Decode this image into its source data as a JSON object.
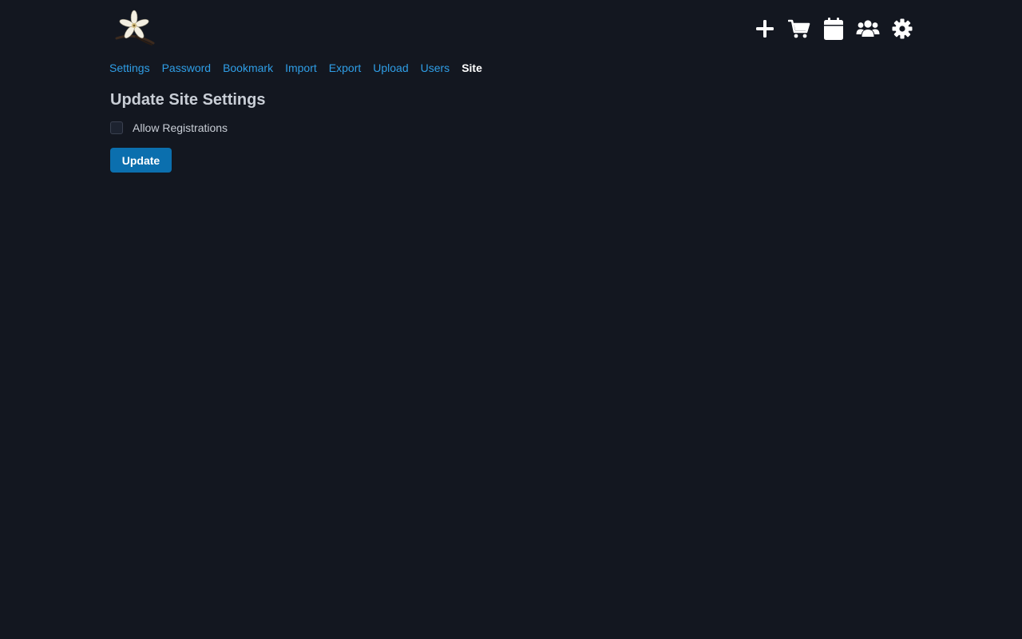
{
  "header": {
    "logo_icon": "vanilla-flower-icon",
    "toolbar": [
      {
        "icon": "plus-icon",
        "name": "add"
      },
      {
        "icon": "cart-icon",
        "name": "cart"
      },
      {
        "icon": "calendar-icon",
        "name": "calendar"
      },
      {
        "icon": "users-icon",
        "name": "users"
      },
      {
        "icon": "gear-icon",
        "name": "settings"
      }
    ]
  },
  "nav": {
    "items": [
      {
        "label": "Settings",
        "active": false
      },
      {
        "label": "Password",
        "active": false
      },
      {
        "label": "Bookmark",
        "active": false
      },
      {
        "label": "Import",
        "active": false
      },
      {
        "label": "Export",
        "active": false
      },
      {
        "label": "Upload",
        "active": false
      },
      {
        "label": "Users",
        "active": false
      },
      {
        "label": "Site",
        "active": true
      }
    ]
  },
  "main": {
    "title": "Update Site Settings",
    "allow_registrations": {
      "label": "Allow Registrations",
      "checked": false
    },
    "update_label": "Update"
  },
  "colors": {
    "background": "#131720",
    "link": "#2f9ee6",
    "button": "#0b6fae",
    "text": "#c9ced6"
  }
}
